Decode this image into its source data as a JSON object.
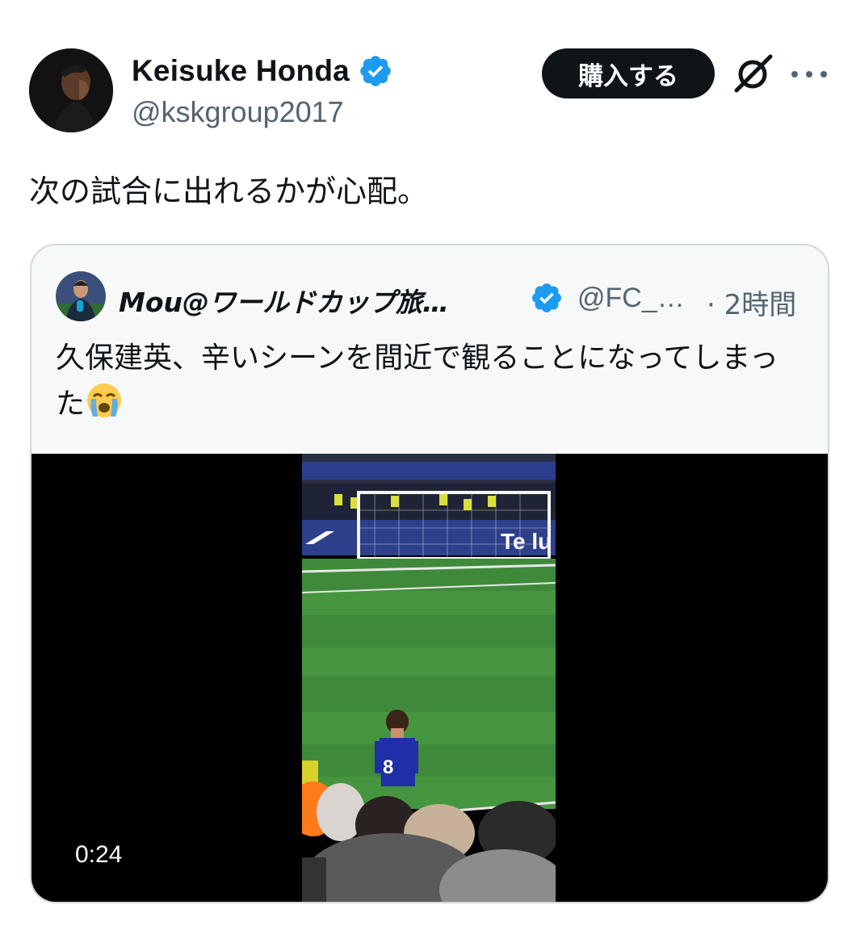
{
  "author": {
    "display_name": "Keisuke Honda",
    "handle": "@kskgroup2017",
    "verified": true
  },
  "actions": {
    "buy_label": "購入する",
    "grok_icon": "grok-icon",
    "more_icon": "more-icon"
  },
  "tweet": {
    "text": "次の試合に出れるかが心配。"
  },
  "quoted": {
    "display_name": "Mou@ワールドカップ旅…",
    "handle": "@FC_…",
    "time": "· 2時間",
    "verified": true,
    "text": "久保建英、辛いシーンを間近で観ることになってしまった",
    "emoji": "loudly-crying-face-icon",
    "video": {
      "duration": "0:24",
      "banner_text": "Te lu"
    }
  },
  "colors": {
    "verified_blue": "#1d9bf0",
    "text_primary": "#0f1419",
    "text_secondary": "#536471",
    "border": "#cfd9de"
  }
}
